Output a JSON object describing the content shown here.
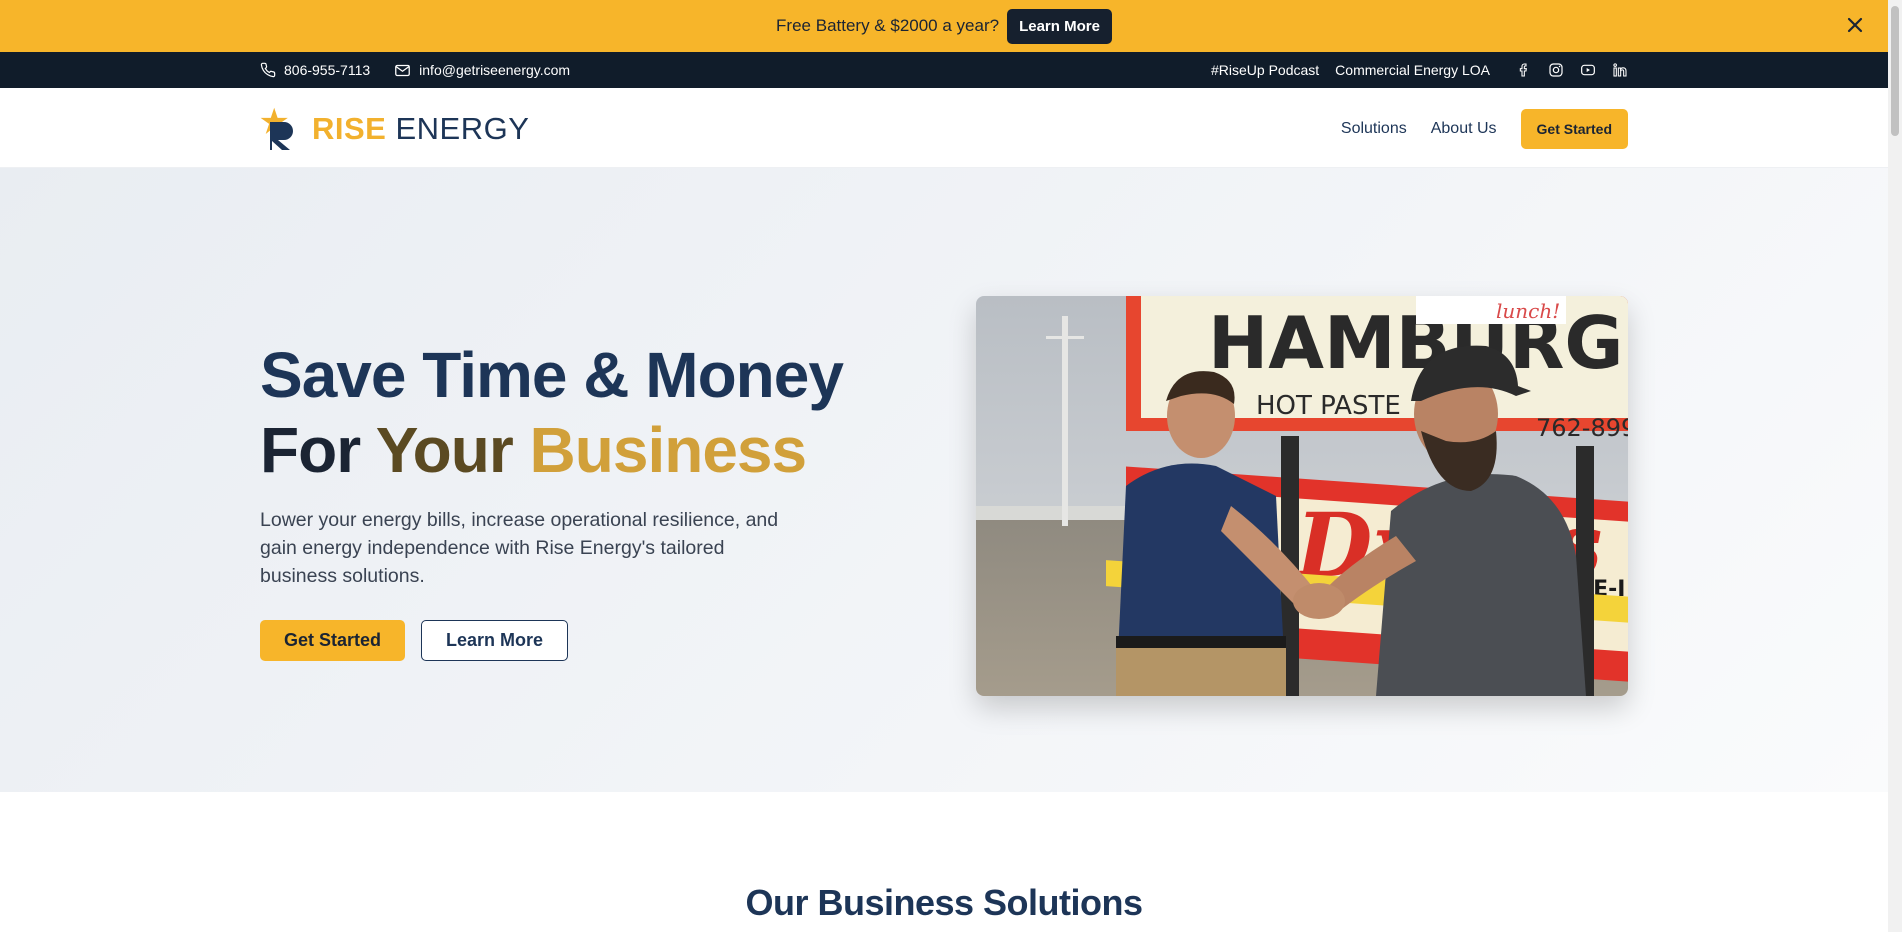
{
  "promo": {
    "text": "Free Battery & $2000 a year?",
    "button_label": "Learn More"
  },
  "topbar": {
    "phone": "806-955-7113",
    "email": "info@getriseenergy.com",
    "links": [
      "#RiseUp Podcast",
      "Commercial Energy LOA"
    ],
    "social_icons": [
      "facebook-icon",
      "instagram-icon",
      "youtube-icon",
      "linkedin-icon"
    ]
  },
  "header": {
    "logo_rise": "RISE",
    "logo_energy": "ENERGY",
    "nav": [
      "Solutions",
      "About Us"
    ],
    "cta": "Get Started"
  },
  "hero": {
    "title_line1": "Save Time & Money",
    "title_for": "For",
    "title_your": "Your",
    "title_business": "Business",
    "subtitle": "Lower your energy bills, increase operational resilience, and gain energy independence with Rise Energy's tailored business solutions.",
    "primary_btn": "Get Started",
    "secondary_btn": "Learn More",
    "photo": {
      "sign_main": "HAMBURGER",
      "sign_sub": "HOT PASTE",
      "sign_phone": "762-899",
      "sign_top": "lunch!",
      "sign_script": "Dyer's",
      "sign_drive": "RIVE-I"
    }
  },
  "solutions": {
    "title": "Our Business Solutions"
  },
  "colors": {
    "accent": "#f7b52a",
    "navy": "#1d3557",
    "dark": "#101c2a"
  }
}
